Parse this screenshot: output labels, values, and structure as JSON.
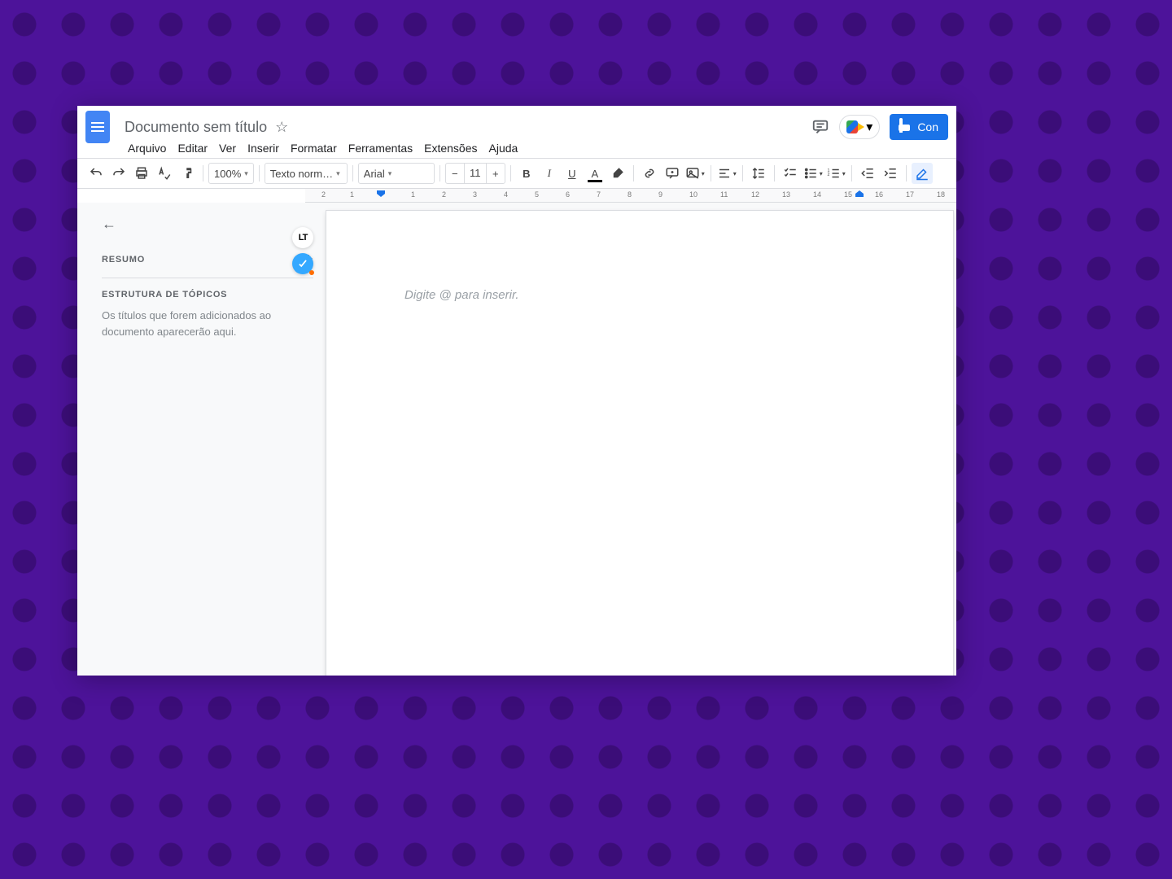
{
  "header": {
    "doc_title": "Documento sem título",
    "share_label": "Con"
  },
  "menus": [
    "Arquivo",
    "Editar",
    "Ver",
    "Inserir",
    "Formatar",
    "Ferramentas",
    "Extensões",
    "Ajuda"
  ],
  "toolbar": {
    "zoom": "100%",
    "style": "Texto norm…",
    "font": "Arial",
    "font_size": "11"
  },
  "ruler": {
    "left_labels": [
      "2",
      "1"
    ],
    "right_labels": [
      "1",
      "2",
      "3",
      "4",
      "5",
      "6",
      "7",
      "8",
      "9",
      "10",
      "11",
      "12",
      "13",
      "14",
      "15",
      "16",
      "17",
      "18"
    ]
  },
  "outline": {
    "resumo_title": "RESUMO",
    "estrutura_title": "ESTRUTURA DE TÓPICOS",
    "empty_text": "Os títulos que forem adicionados ao documento aparecerão aqui."
  },
  "plugins": {
    "lt_label": "LT"
  },
  "document": {
    "placeholder": "Digite @ para inserir."
  }
}
